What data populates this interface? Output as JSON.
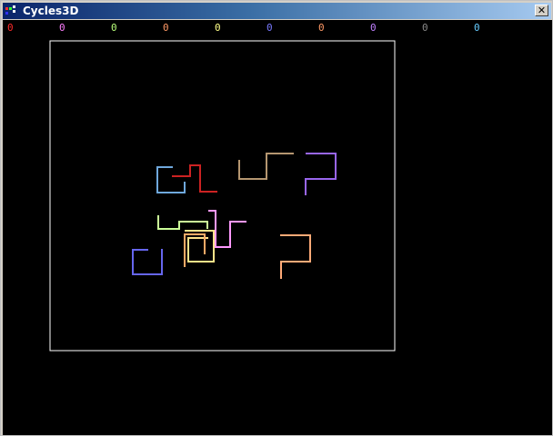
{
  "window": {
    "title": "Cycles3D",
    "close_glyph": "✕"
  },
  "scores": [
    {
      "value": "0",
      "color": "#ff2a2a"
    },
    {
      "value": "0",
      "color": "#ff7fff"
    },
    {
      "value": "0",
      "color": "#b8ff7a"
    },
    {
      "value": "0",
      "color": "#ff9966"
    },
    {
      "value": "0",
      "color": "#ffff88"
    },
    {
      "value": "0",
      "color": "#7a7aff"
    },
    {
      "value": "0",
      "color": "#ff9966"
    },
    {
      "value": "0",
      "color": "#c080ff"
    },
    {
      "value": "0",
      "color": "#888888"
    },
    {
      "value": "0",
      "color": "#66ccff"
    }
  ],
  "arena": {
    "border_color": "#ffffff",
    "background": "#000000"
  },
  "trails": [
    {
      "color": "#6fa8dc"
    },
    {
      "color": "#cc2222"
    },
    {
      "color": "#b59670"
    },
    {
      "color": "#9966ee"
    },
    {
      "color": "#ccff99"
    },
    {
      "color": "#ff99ff"
    },
    {
      "color": "#ffe38a"
    },
    {
      "color": "#ffaa66"
    },
    {
      "color": "#6666ee"
    },
    {
      "color": "#ffaa77"
    }
  ]
}
